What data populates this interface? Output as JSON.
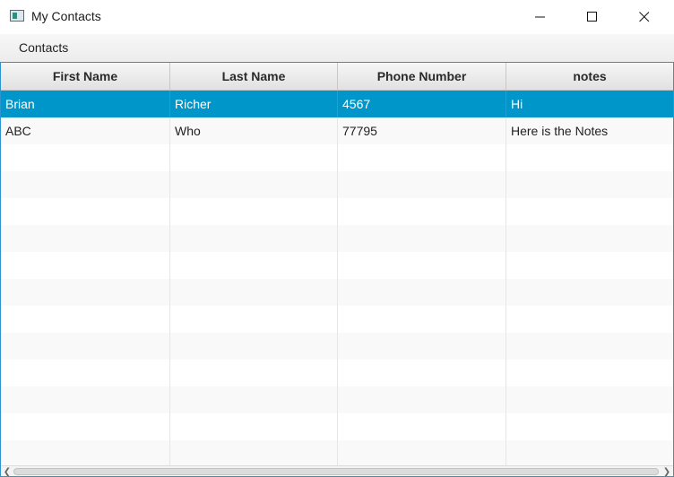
{
  "window": {
    "title": "My Contacts",
    "controls": {
      "minimize": "minimize-icon",
      "maximize": "maximize-icon",
      "close": "close-icon"
    }
  },
  "menubar": {
    "items": [
      {
        "label": "Contacts"
      }
    ]
  },
  "table": {
    "columns": [
      "First Name",
      "Last Name",
      "Phone Number",
      "notes"
    ],
    "rows": [
      [
        "Brian",
        "Richer",
        "4567",
        "Hi"
      ],
      [
        "ABC",
        "Who",
        "77795",
        "Here is the Notes"
      ]
    ],
    "selected_row": 0
  },
  "colors": {
    "accent": "#0096c9",
    "border": "#2c95d0"
  }
}
